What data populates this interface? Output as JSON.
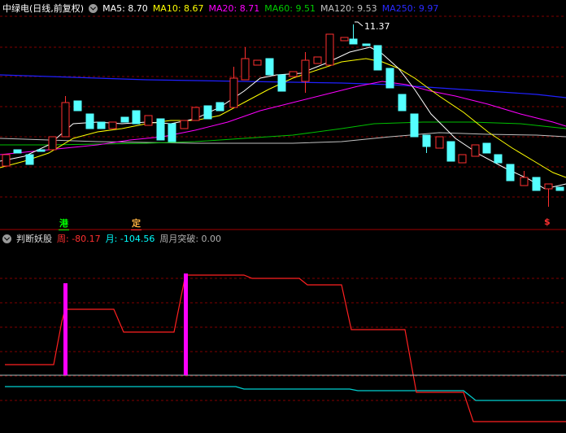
{
  "main": {
    "title": "中绿电(日线,前复权)",
    "ma": [
      {
        "label": "MA5: 8.70",
        "color": "#ffffff"
      },
      {
        "label": "MA10: 8.67",
        "color": "#ffff00"
      },
      {
        "label": "MA20: 8.71",
        "color": "#ff00ff"
      },
      {
        "label": "MA60: 9.51",
        "color": "#00cc00"
      },
      {
        "label": "MA120: 9.53",
        "color": "#c0c0c0"
      },
      {
        "label": "MA250: 9.97",
        "color": "#0000ff"
      }
    ],
    "peak_label": "11.37",
    "marks": [
      {
        "text": "港",
        "color": "#00ff00"
      },
      {
        "text": "定",
        "color": "#ffb040"
      },
      {
        "text": "$",
        "color": "#ff3030"
      }
    ]
  },
  "indicator": {
    "name": "判断妖股",
    "values": [
      {
        "label": "周: -80.17",
        "color": "#ff3030"
      },
      {
        "label": "月: -104.56",
        "color": "#00ffff"
      },
      {
        "label": "周月突破: 0.00",
        "color": "#c0c0c0"
      }
    ]
  },
  "colors": {
    "up": "#ff3030",
    "down": "#54ffff",
    "grid": "#800000",
    "divider": "#800000"
  }
}
